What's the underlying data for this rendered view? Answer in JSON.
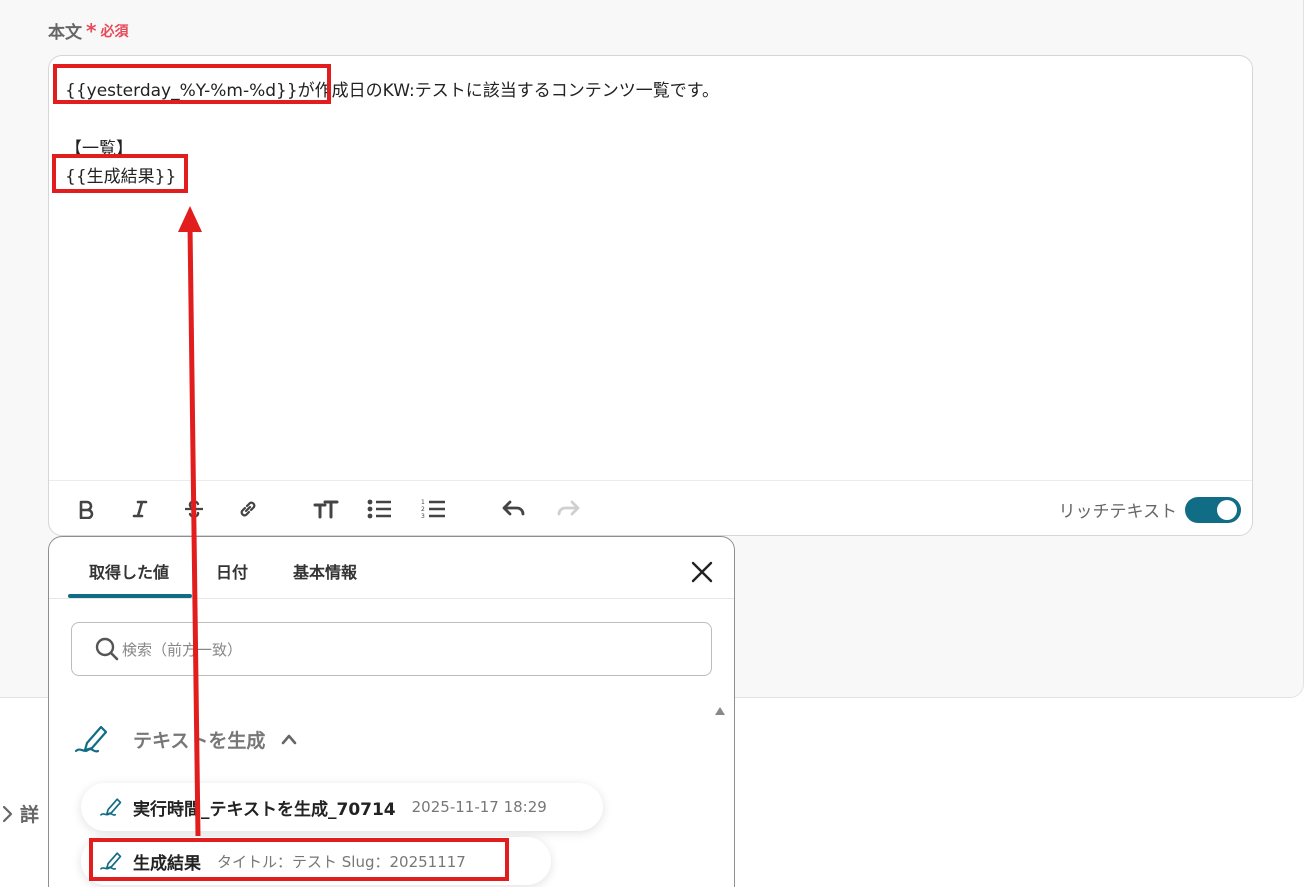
{
  "field": {
    "label": "本文",
    "required_mark": "*",
    "required_text": "必須"
  },
  "editor": {
    "line1_token": "{{yesterday_%Y-%m-%d}}",
    "line1_rest": "が作成日のKW:テストに該当するコンテンツ一覧です。",
    "line3": "【一覧】",
    "line4_token": "{{生成結果}}",
    "toolbar": {
      "icons": [
        "bold-icon",
        "italic-icon",
        "strikethrough-icon",
        "link-icon",
        "text-size-icon",
        "bulleted-list-icon",
        "numbered-list-icon",
        "undo-icon",
        "redo-icon"
      ],
      "rich_text_label": "リッチテキスト",
      "rich_text_enabled": true
    }
  },
  "picker": {
    "tabs": [
      {
        "label": "取得した値",
        "active": true
      },
      {
        "label": "日付",
        "active": false
      },
      {
        "label": "基本情報",
        "active": false
      }
    ],
    "search": {
      "placeholder": "検索（前方一致）",
      "value": ""
    },
    "group": {
      "title": "テキストを生成",
      "expanded": true,
      "items": [
        {
          "name": "実行時間_テキストを生成_70714",
          "value": "2025-11-17 18:29"
        },
        {
          "name": "生成結果",
          "value": "タイトル：テスト Slug：20251117"
        }
      ]
    }
  },
  "details": {
    "label": "詳"
  },
  "colors": {
    "accent": "#116d86",
    "required": "#e64b5a",
    "annotation": "#e11d1d"
  }
}
